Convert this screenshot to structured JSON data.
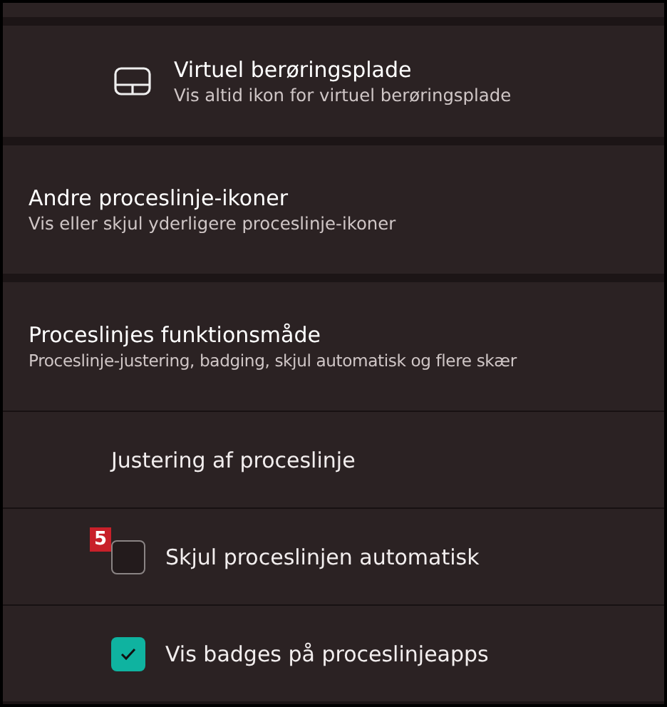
{
  "settings": [
    {
      "kind": "icon-row",
      "title": "Virtuel berøringsplade",
      "description": "Vis altid ikon for virtuel berøringsplade"
    },
    {
      "kind": "plain",
      "title": "Andre proceslinje-ikoner",
      "description": "Vis eller skjul yderligere proceslinje-ikoner"
    },
    {
      "kind": "expander",
      "title": "Proceslinjes funktionsmåde",
      "description": "Proceslinje-justering, badging, skjul automatisk og flere skær",
      "children": [
        {
          "kind": "label",
          "label": "Justering af proceslinje"
        },
        {
          "kind": "checkbox",
          "label": "Skjul proceslinjen automatisk",
          "checked": false,
          "annotation": "5"
        },
        {
          "kind": "checkbox",
          "label": "Vis badges på proceslinjeapps",
          "checked": true
        }
      ]
    }
  ]
}
